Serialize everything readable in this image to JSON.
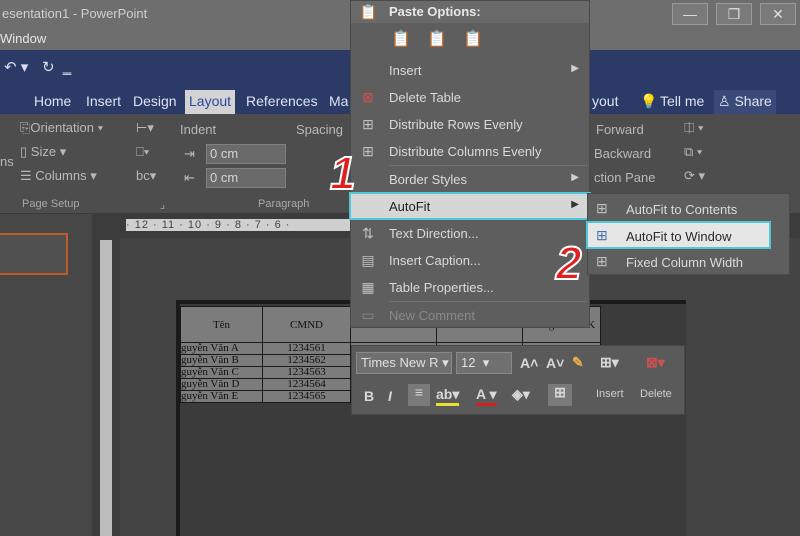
{
  "app": {
    "title": "esentation1 - PowerPoint",
    "window_menu": "Window",
    "window_buttons": {
      "minimize": "—",
      "restore": "❐",
      "close": "✕"
    }
  },
  "ribbon": {
    "tabs": [
      "Home",
      "Insert",
      "Design",
      "Layout",
      "References",
      "Ma",
      "yout"
    ],
    "active_tab": "Layout",
    "tell_me": "Tell me",
    "share": "Share",
    "orientation": "Orientation",
    "size": "Size",
    "columns": "Columns",
    "left_cut": "ns",
    "page_setup": "Page Setup",
    "indent": "Indent",
    "spacing": "Spacing",
    "indent_left": "0 cm",
    "indent_right": "0 cm",
    "paragraph": "Paragraph",
    "bring_forward": "Forward",
    "send_backward": "Backward",
    "selection_pane": "ction Pane"
  },
  "ruler": {
    "top": "· 12 · 11 · 10 · 9 · 8 · 7 · 6 ·"
  },
  "table": {
    "headers": [
      "Tên",
      "CMND",
      "Trung bình HK"
    ],
    "rows": [
      [
        "guyễn Văn A",
        "1234561"
      ],
      [
        "guyễn Văn B",
        "1234562"
      ],
      [
        "guyễn Văn C",
        "1234563"
      ],
      [
        "guyễn Văn D",
        "1234564"
      ],
      [
        "guyễn Văn E",
        "1234565"
      ]
    ]
  },
  "context_menu": {
    "paste_options": "Paste Options:",
    "items": {
      "insert": "Insert",
      "delete_table": "Delete Table",
      "distribute_rows": "Distribute Rows Evenly",
      "distribute_columns": "Distribute Columns Evenly",
      "border_styles": "Border Styles",
      "autofit": "AutoFit",
      "text_direction": "Text Direction...",
      "insert_caption": "Insert Caption...",
      "table_properties": "Table Properties...",
      "new_comment": "New Comment"
    }
  },
  "autofit_submenu": {
    "contents": "AutoFit to Contents",
    "window": "AutoFit to Window",
    "fixed": "Fixed Column Width"
  },
  "mini_toolbar": {
    "font": "Times New R",
    "size": "12",
    "insert": "Insert",
    "delete": "Delete"
  },
  "steps": {
    "one": "1",
    "two": "2"
  },
  "colors": {
    "highlight_border": "#4fc7d8",
    "step_red": "#e0201e",
    "layout_tab": "#2b4a9a"
  }
}
